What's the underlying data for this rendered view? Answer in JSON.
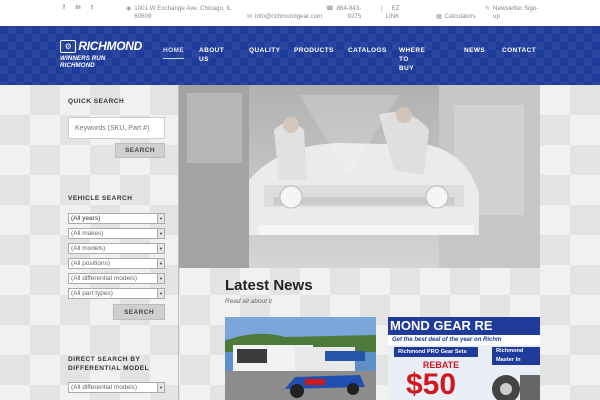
{
  "topbar": {
    "social": [
      {
        "icon": "facebook-icon",
        "glyph": "f"
      },
      {
        "icon": "linkedin-icon",
        "glyph": "in"
      },
      {
        "icon": "twitter-icon",
        "glyph": "t"
      }
    ],
    "address_line1": "1001 W Exchange Ave. Chicago, IL",
    "address_line2": "60609",
    "email": "info@richmondgear.com",
    "phone_line1": "864-843-",
    "phone_line2": "9275",
    "link_line1": "EZ",
    "link_line2": "LINK",
    "calculators": "Calculators",
    "newsletter_line1": "Newsletter Sign-",
    "newsletter_line2": "up"
  },
  "header": {
    "logo_name": "RICHMOND",
    "logo_tagline": "WINNERS RUN RICHMOND",
    "nav": [
      {
        "label": "HOME",
        "label2": "",
        "active": true
      },
      {
        "label": "ABOUT",
        "label2": "US",
        "active": false
      },
      {
        "label": "QUALITY",
        "label2": "",
        "active": false
      },
      {
        "label": "PRODUCTS",
        "label2": "",
        "active": false
      },
      {
        "label": "CATALOGS",
        "label2": "",
        "active": false
      },
      {
        "label": "WHERE TO",
        "label2": "BUY",
        "active": false
      },
      {
        "label": "NEWS",
        "label2": "",
        "active": false
      },
      {
        "label": "CONTACT",
        "label2": "",
        "active": false
      }
    ]
  },
  "sidebar": {
    "quick_search": {
      "title": "QUICK SEARCH",
      "placeholder": "Keywords (SKU, Part #)",
      "button": "SEARCH"
    },
    "vehicle_search": {
      "title": "VEHICLE SEARCH",
      "selects": [
        "(All years)",
        "(All makes)",
        "(All models)",
        "(All positions)",
        "(All differential models)",
        "(All part types)"
      ],
      "button": "SEARCH"
    },
    "direct_search": {
      "title_line1": "DIRECT SEARCH BY",
      "title_line2": "DIFFERENTIAL MODEL",
      "select": "(All differential models)"
    }
  },
  "news": {
    "title": "Latest News",
    "subtitle": "Read all about it",
    "card2_banner": "MOND GEAR RE",
    "card2_line": "Get the best deal of the year on Richm",
    "card2_sub1": "Richmond PRO Gear Sets",
    "card2_sub2": "Richmond",
    "card2_sub3": "Master In",
    "card2_rebate": "REBATE",
    "card2_amount": "$50"
  },
  "colors": {
    "header_blue": "#1f3c9a",
    "rebate_red": "#d0191f"
  }
}
